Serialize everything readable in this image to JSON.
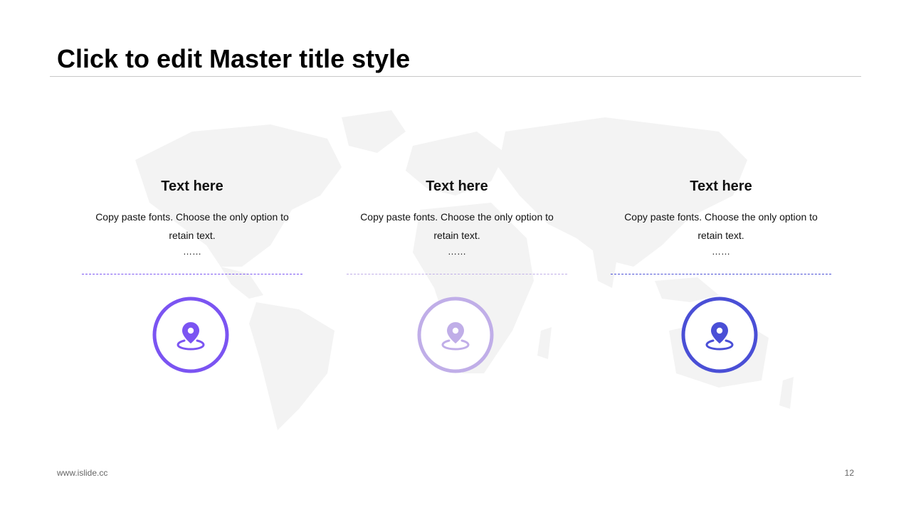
{
  "slide": {
    "title": "Click to edit Master title style",
    "footer_site": "www.islide.cc",
    "page_number": "12"
  },
  "colors": {
    "purple": "#7b54f2",
    "lavender": "#c0aee8",
    "blue": "#4a4fd6",
    "map": "#f3f3f3"
  },
  "cards": [
    {
      "heading": "Text here",
      "body_line1": "Copy paste fonts. Choose the only option to",
      "body_line2": "retain text.",
      "dots": "……",
      "icon": "location-pin-icon",
      "accent": "#7b54f2"
    },
    {
      "heading": "Text here",
      "body_line1": "Copy paste fonts. Choose the only option to",
      "body_line2": "retain text.",
      "dots": "……",
      "icon": "location-pin-icon",
      "accent": "#c0aee8"
    },
    {
      "heading": "Text here",
      "body_line1": "Copy paste fonts. Choose the only option to",
      "body_line2": "retain text.",
      "dots": "……",
      "icon": "location-pin-icon",
      "accent": "#4a4fd6"
    }
  ]
}
